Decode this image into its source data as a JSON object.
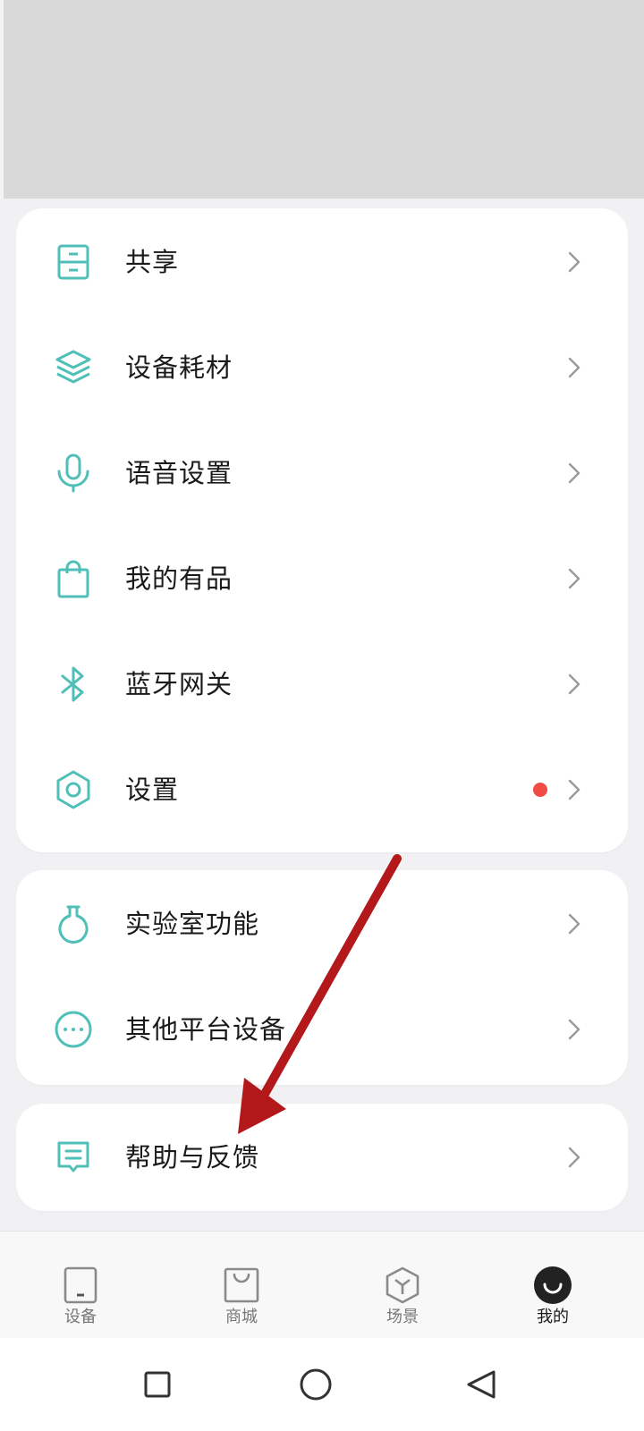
{
  "colors": {
    "accent": "#4fbfb8",
    "badge": "#f24a44",
    "annotation_arrow": "#b3191a"
  },
  "menu_group_1": [
    {
      "label": "共享",
      "icon": "share-drawer-icon"
    },
    {
      "label": "设备耗材",
      "icon": "layers-icon"
    },
    {
      "label": "语音设置",
      "icon": "microphone-icon"
    },
    {
      "label": "我的有品",
      "icon": "shopping-bag-icon"
    },
    {
      "label": "蓝牙网关",
      "icon": "bluetooth-icon"
    },
    {
      "label": "设置",
      "icon": "hexagon-settings-icon",
      "badge_dot": true
    }
  ],
  "menu_group_2": [
    {
      "label": "实验室功能",
      "icon": "flask-icon"
    },
    {
      "label": "其他平台设备",
      "icon": "more-dots-icon"
    }
  ],
  "menu_group_3": [
    {
      "label": "帮助与反馈",
      "icon": "feedback-message-icon"
    }
  ],
  "tabbar": [
    {
      "label": "设备",
      "icon": "device-tab-icon",
      "active": false
    },
    {
      "label": "商城",
      "icon": "store-bag-tab-icon",
      "active": false
    },
    {
      "label": "场景",
      "icon": "scene-cube-tab-icon",
      "active": false
    },
    {
      "label": "我的",
      "icon": "profile-smile-tab-icon",
      "active": true
    }
  ],
  "system_nav": [
    "recent-apps-square-icon",
    "home-circle-icon",
    "back-triangle-icon"
  ]
}
